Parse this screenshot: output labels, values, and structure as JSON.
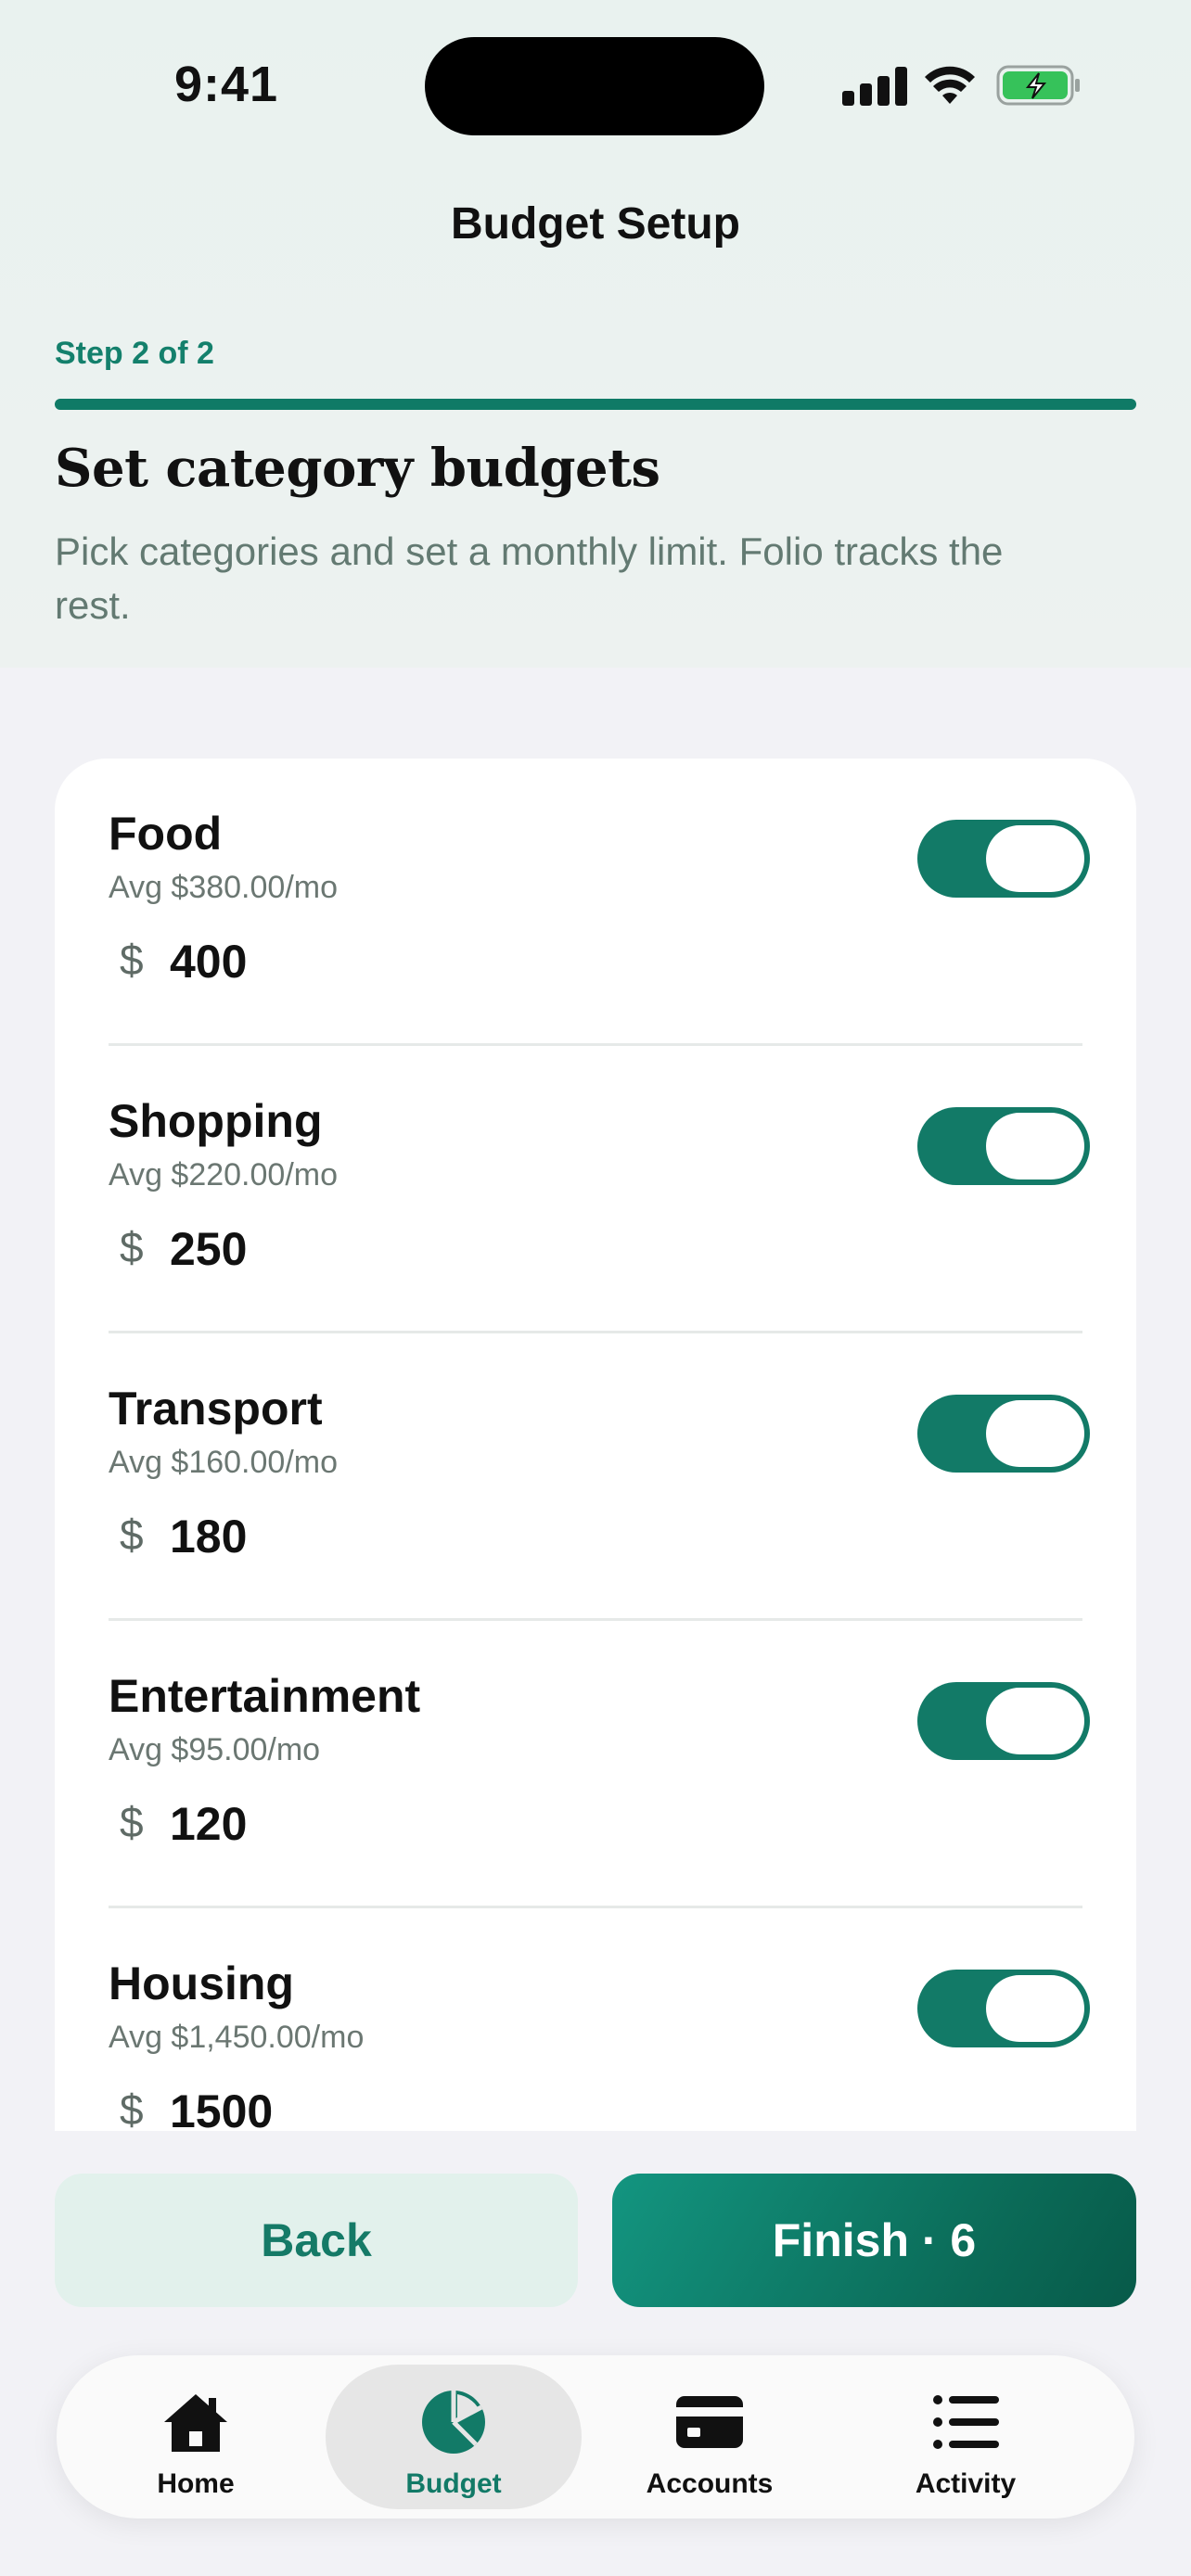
{
  "status_bar": {
    "time": "9:41"
  },
  "header": {
    "title": "Budget Setup"
  },
  "step": {
    "label": "Step 2 of 2",
    "progress": 1.0
  },
  "intro": {
    "heading": "Set category budgets",
    "subtitle": "Pick categories and set a monthly limit. Folio tracks the rest."
  },
  "categories": [
    {
      "name": "Food",
      "avg": "Avg $380.00/mo",
      "currency": "$",
      "amount": "400",
      "enabled": true
    },
    {
      "name": "Shopping",
      "avg": "Avg $220.00/mo",
      "currency": "$",
      "amount": "250",
      "enabled": true
    },
    {
      "name": "Transport",
      "avg": "Avg $160.00/mo",
      "currency": "$",
      "amount": "180",
      "enabled": true
    },
    {
      "name": "Entertainment",
      "avg": "Avg $95.00/mo",
      "currency": "$",
      "amount": "120",
      "enabled": true
    },
    {
      "name": "Housing",
      "avg": "Avg $1,450.00/mo",
      "currency": "$",
      "amount": "1500",
      "enabled": true
    }
  ],
  "actions": {
    "back_label": "Back",
    "finish_label": "Finish · 6"
  },
  "tabbar": {
    "items": [
      {
        "label": "Home",
        "icon": "home-icon",
        "active": false
      },
      {
        "label": "Budget",
        "icon": "pie-chart-icon",
        "active": true
      },
      {
        "label": "Accounts",
        "icon": "credit-card-icon",
        "active": false
      },
      {
        "label": "Activity",
        "icon": "list-icon",
        "active": false
      }
    ]
  },
  "colors": {
    "accent": "#127a67",
    "accent_light": "#e2f1ec",
    "background": "#f2f2f6"
  }
}
